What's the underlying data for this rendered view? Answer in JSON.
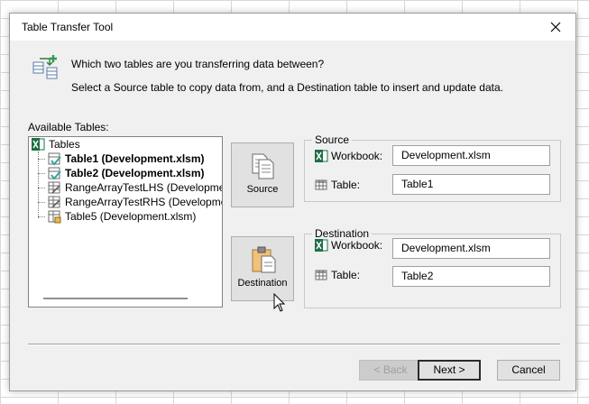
{
  "window": {
    "title": "Table Transfer Tool"
  },
  "header": {
    "question": "Which two tables are you transferring data between?",
    "instruction": "Select a Source table to copy data from, and a Destination table to insert and update data."
  },
  "tables_panel": {
    "label": "Available Tables:",
    "root": "Tables",
    "items": [
      {
        "label": "Table1 (Development.xlsm)",
        "bold": true
      },
      {
        "label": "Table2 (Development.xlsm)",
        "bold": true
      },
      {
        "label": "RangeArrayTestLHS (Development.xlsm)",
        "bold": false
      },
      {
        "label": "RangeArrayTestRHS (Development.xlsm)",
        "bold": false
      },
      {
        "label": "Table5 (Development.xlsm)",
        "bold": false
      }
    ]
  },
  "source_button": {
    "label": "Source"
  },
  "destination_button": {
    "label": "Destination"
  },
  "source": {
    "title": "Source",
    "workbook_label": "Workbook:",
    "workbook_value": "Development.xlsm",
    "table_label": "Table:",
    "table_value": "Table1"
  },
  "destination": {
    "title": "Destination",
    "workbook_label": "Workbook:",
    "workbook_value": "Development.xlsm",
    "table_label": "Table:",
    "table_value": "Table2"
  },
  "footer": {
    "back_label": "< Back",
    "next_label": "Next >",
    "cancel_label": "Cancel"
  },
  "colors": {
    "excel_green": "#1d6f42",
    "check_teal": "#3aa39c",
    "clipboard_tan": "#f0c27a",
    "dialog_bg": "#f0f0f0"
  }
}
